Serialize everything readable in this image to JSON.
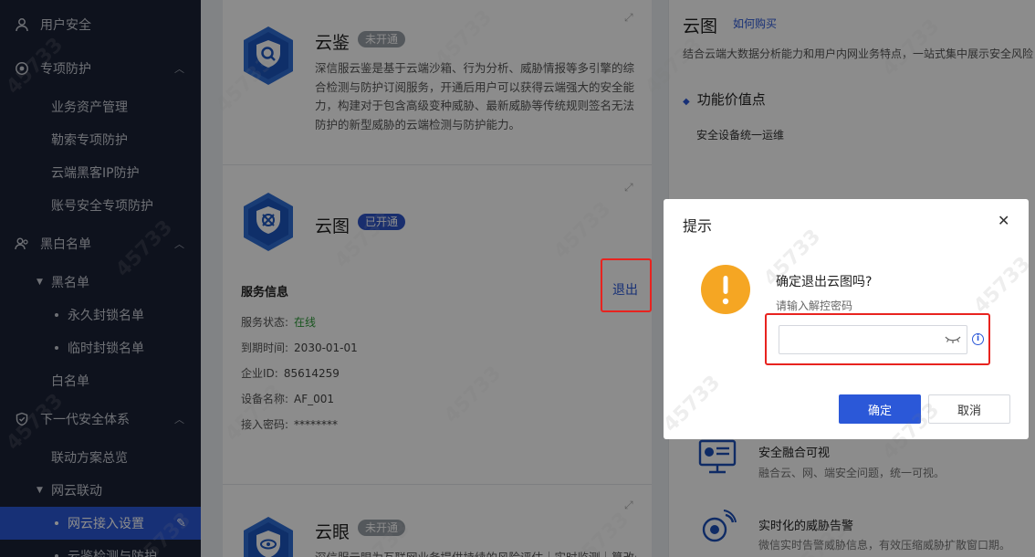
{
  "sidebar": {
    "items": [
      {
        "label": "用户安全",
        "icon": "user-icon"
      },
      {
        "label": "专项防护",
        "icon": "target-icon"
      },
      {
        "label": "业务资产管理"
      },
      {
        "label": "勒索专项防护"
      },
      {
        "label": "云端黑客IP防护"
      },
      {
        "label": "账号安全专项防护"
      },
      {
        "label": "黑白名单",
        "icon": "users-icon"
      },
      {
        "label": "黑名单"
      },
      {
        "label": "永久封锁名单"
      },
      {
        "label": "临时封锁名单"
      },
      {
        "label": "白名单"
      },
      {
        "label": "下一代安全体系",
        "icon": "shield-check-icon"
      },
      {
        "label": "联动方案总览"
      },
      {
        "label": "网云联动"
      },
      {
        "label": "网云接入设置"
      },
      {
        "label": "云鉴检测与防护"
      }
    ]
  },
  "cards": {
    "yunjian": {
      "title": "云鉴",
      "badge": "未开通",
      "desc": "深信服云鉴是基于云端沙箱、行为分析、威胁情报等多引擎的综合检测与防护订阅服务，开通后用户可以获得云端强大的安全能力，构建对于包含高级变种威胁、最新威胁等传统规则签名无法防护的新型威胁的云端检测与防护能力。"
    },
    "yuntu": {
      "title": "云图",
      "badge": "已开通",
      "logout": "退出",
      "service_title": "服务信息",
      "fields": [
        {
          "label": "服务状态:",
          "value": "在线"
        },
        {
          "label": "到期时间:",
          "value": "2030-01-01"
        },
        {
          "label": "企业ID:",
          "value": "85614259"
        },
        {
          "label": "设备名称:",
          "value": "AF_001"
        },
        {
          "label": "接入密码:",
          "value": "********"
        }
      ]
    },
    "yunyan": {
      "title": "云眼",
      "badge": "未开通",
      "desc": "深信服云眼为互联网业务提供持续的风险评估｜实时监测｜篡改处"
    }
  },
  "right": {
    "title": "云图",
    "buy_link": "如何购买",
    "intro": "结合云端大数据分析能力和用户内网业务特点，一站式集中展示安全风险",
    "section_title": "功能价值点",
    "point1": "安全设备统一运维",
    "feature1_title": "安全融合可视",
    "feature1_desc": "融合云、网、端安全问题，统一可视。",
    "feature2_title": "实时化的威胁告警",
    "feature2_desc": "微信实时告警威胁信息，有效压缩威胁扩散窗口期。"
  },
  "dialog": {
    "title": "提示",
    "question": "确定退出云图吗?",
    "input_label": "请输入解控密码",
    "input_value": "",
    "confirm": "确定",
    "cancel": "取消"
  },
  "watermark": "45733",
  "colors": {
    "primary": "#2b58d8",
    "warning": "#f5a623",
    "highlight": "#e8231f",
    "online": "#2f9c3a"
  }
}
